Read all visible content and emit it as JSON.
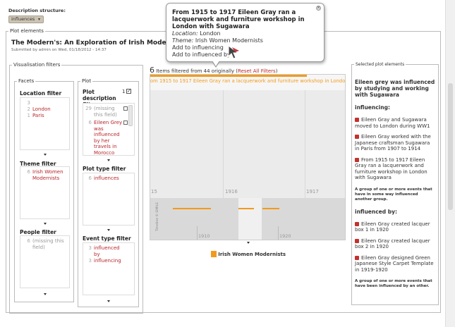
{
  "header": {
    "desc_label": "Description structure:",
    "desc_value": "influences"
  },
  "plot_elements_legend": "Plot elements",
  "article": {
    "title": "The Modern's: An Exploration of Irish Modern Art fr",
    "submitted": "Submitted by admin on Wed, 01/18/2012 - 14:37"
  },
  "visualisation_filters_legend": "Visualisation filters",
  "facets": {
    "legend": "Facets",
    "location": {
      "title": "Location filter",
      "items": [
        {
          "count": "3",
          "label": ""
        },
        {
          "count": "2",
          "label": "London"
        },
        {
          "count": "1",
          "label": "Paris"
        }
      ]
    },
    "theme": {
      "title": "Theme filter",
      "items": [
        {
          "count": "6",
          "label": "Irish Women Modernists"
        }
      ]
    },
    "people": {
      "title": "People filter",
      "items": [
        {
          "count": "6",
          "label": "(missing this field)"
        }
      ]
    }
  },
  "plot": {
    "legend": "Plot",
    "desc_filter": {
      "title": "Plot description filter",
      "count": "1",
      "items": [
        {
          "count": "29",
          "label": "(missing this field)"
        },
        {
          "count": "6",
          "label": "Eileen Grey was influenced by her travels in Morocco"
        }
      ]
    },
    "type_filter": {
      "title": "Plot type filter",
      "items": [
        {
          "count": "6",
          "label": "influences"
        }
      ]
    },
    "event_filter": {
      "title": "Event type filter",
      "items": [
        {
          "count": "3",
          "label": "influenced by"
        },
        {
          "count": "3",
          "label": "influencing"
        }
      ]
    }
  },
  "timeline": {
    "count": "6",
    "filtered_text": "Items filtered from 44 originally",
    "reset_text": "Reset All Filters",
    "event_label": "om 1915 to 1917 Eileen Gray ran a lacquerwork and furniture workshop in London •",
    "year_labels": [
      "15",
      "1916",
      "1917"
    ],
    "overview_years": [
      "1910",
      "1920"
    ],
    "credit": "Timeline © SIMILE",
    "legend_label": "Irish Women Modernists"
  },
  "popup": {
    "title": "From 1915 to 1917 Eileen Gray ran a lacquerwork and furniture workshop in London with Sugawara",
    "location_label": "Location:",
    "location_value": "London",
    "theme_label": "Theme:",
    "theme_value": "Irish Women Modernists",
    "add_influencing": "Add to influencing",
    "add_influenced_by": "Add to influenced by"
  },
  "selected": {
    "legend": "Selected plot elements",
    "heading": "Eileen grey was influenced by studying and working with Sugawara",
    "influencing_title": "influencing:",
    "influencing": [
      "Eileen Gray and Sugawara moved to London during WW1",
      "Eileen Gray worked with the Japanese craftsman Sugawara in Paris from 1907 to 1914",
      "From 1915 to 1917 Eileen Gray ran a lacquerwork and furniture workshop in London with Sugawara"
    ],
    "influencing_note": "A group of one or more events that have in some way influenced another group.",
    "influenced_title": "influenced by:",
    "influenced": [
      "Eileen Gray created lacquer box 1 in 1920",
      "Eileen Gray created lacquer box 2 in 1920",
      "Eileen Gray designed Green Japanese Style Carpet Template in 1919-1920"
    ],
    "influenced_note": "A group of one or more events that have been influenced by an other."
  },
  "colors": {
    "accent_orange": "#f29a1d",
    "link_red": "#b8262b"
  }
}
